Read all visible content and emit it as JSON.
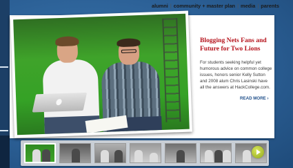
{
  "utility_nav": {
    "items": [
      "alumni",
      "community + master plan",
      "media",
      "parents"
    ]
  },
  "feature": {
    "title": "Blogging Nets Fans and Future for Two Lions",
    "body": "For students seeking helpful yet humorous advice on common college issues, honors senior Kelly Sutton and 2008 alum Chris Lasinski have all the answers at HackCollege.com.",
    "read_more": "READ MORE ›"
  },
  "thumbnails": {
    "count": 7,
    "active_index": 0
  },
  "colors": {
    "accent_red": "#b5121b",
    "link_blue": "#1f4f8a",
    "background_blue": "#2b5f95",
    "next_button_green": "#a7bd2a"
  }
}
